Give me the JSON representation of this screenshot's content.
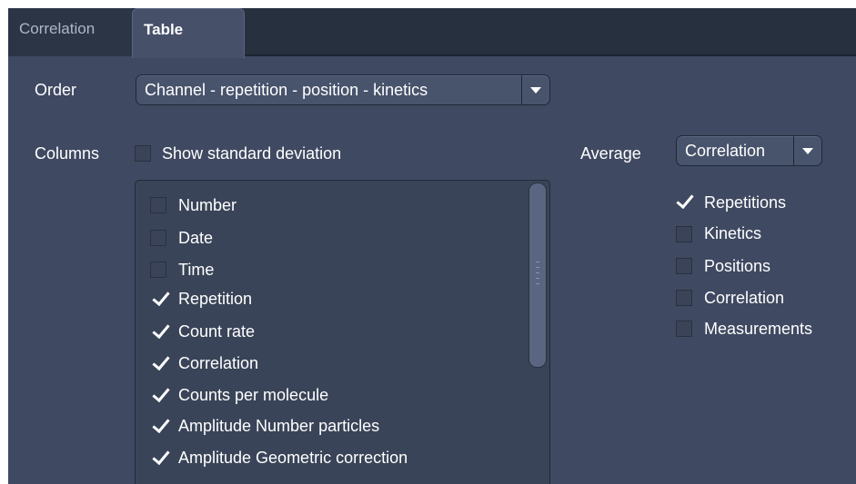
{
  "tabs": [
    {
      "label": "Correlation",
      "active": false
    },
    {
      "label": "Table",
      "active": true
    }
  ],
  "order": {
    "label": "Order",
    "value": "Channel - repetition - position - kinetics"
  },
  "columns": {
    "label": "Columns",
    "show_std": {
      "label": "Show standard deviation",
      "checked": false
    },
    "items": [
      {
        "label": "Number",
        "checked": false
      },
      {
        "label": "Date",
        "checked": false
      },
      {
        "label": "Time",
        "checked": false
      },
      {
        "label": "Repetition",
        "checked": true
      },
      {
        "label": "Count rate",
        "checked": true
      },
      {
        "label": "Correlation",
        "checked": true
      },
      {
        "label": "Counts per molecule",
        "checked": true
      },
      {
        "label": "Amplitude Number particles",
        "checked": true
      },
      {
        "label": "Amplitude Geometric correction",
        "checked": true
      }
    ]
  },
  "average": {
    "label": "Average",
    "value": "Correlation",
    "options": [
      {
        "label": "Repetitions",
        "checked": true
      },
      {
        "label": "Kinetics",
        "checked": false
      },
      {
        "label": "Positions",
        "checked": false
      },
      {
        "label": "Correlation",
        "checked": false
      },
      {
        "label": "Measurements",
        "checked": false
      }
    ]
  },
  "colors": {
    "panel_bg": "#3f4961",
    "tabbar_bg": "#27303f",
    "text": "#ffffff"
  }
}
